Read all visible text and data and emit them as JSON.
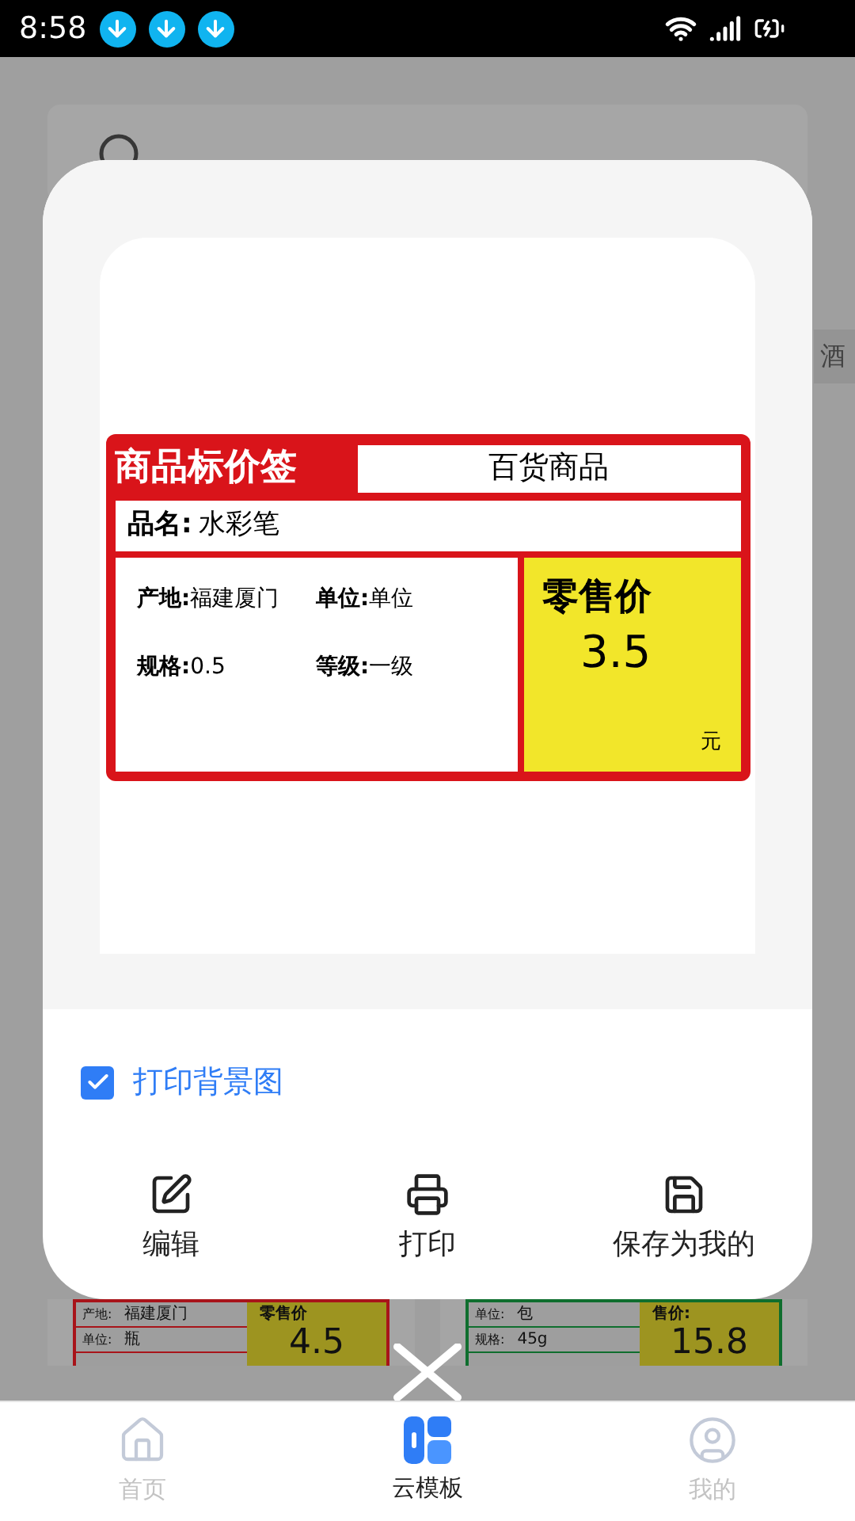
{
  "status_bar": {
    "time": "8:58"
  },
  "category_chip": "酒",
  "background_templates": [
    {
      "color": "#a8141a",
      "rows": [
        {
          "label": "产地:",
          "value": "福建厦门"
        },
        {
          "label": "单位:",
          "value": "瓶"
        }
      ],
      "price_label": "零售价",
      "price": "4.5"
    },
    {
      "color": "#0f6e2e",
      "rows": [
        {
          "label": "单位:",
          "value": "包"
        },
        {
          "label": "规格:",
          "value": "45g"
        }
      ],
      "price_label": "售价:",
      "price": "15.8"
    }
  ],
  "dialog": {
    "label": {
      "title": "商品标价签",
      "category": "百货商品",
      "name_label": "品名:",
      "name": "水彩笔",
      "fields": [
        {
          "label": "产地:",
          "value": "福建厦门"
        },
        {
          "label": "单位:",
          "value": "单位"
        },
        {
          "label": "规格:",
          "value": "0.5"
        },
        {
          "label": "等级:",
          "value": "一级"
        }
      ],
      "price_label": "零售价",
      "price": "3.5",
      "currency": "元"
    },
    "print_background": {
      "label": "打印背景图",
      "checked": true
    },
    "actions": [
      {
        "kind": "edit",
        "label": "编辑"
      },
      {
        "kind": "print",
        "label": "打印"
      },
      {
        "kind": "save",
        "label": "保存为我的"
      }
    ]
  },
  "bottom_nav": [
    {
      "kind": "home",
      "label": "首页",
      "selected": false
    },
    {
      "kind": "templates",
      "label": "云模板",
      "selected": true
    },
    {
      "kind": "profile",
      "label": "我的",
      "selected": false
    }
  ]
}
